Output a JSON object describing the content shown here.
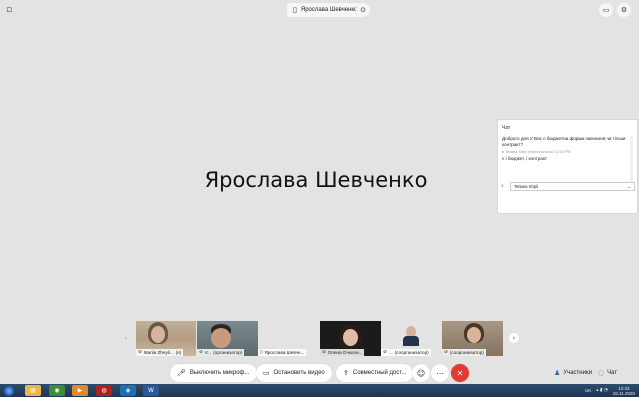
{
  "window": {
    "corner_icon": "window-icon",
    "active_speaker_pill": {
      "icon": "phone-icon",
      "name": "Ярослава Шевченко"
    },
    "pin_icon": "pin-icon",
    "top_right_icons": [
      "fullscreen-icon",
      "settings-icon"
    ]
  },
  "main_stage": {
    "speaker_name": "Ярослава Шевченко"
  },
  "chat": {
    "title": "Чат",
    "message": "Доброго дня.У Вас є бюджетна форма навчання,чи тільки контракт?",
    "meta": "в Tetiana Shpil (персонально)    12:33 PM",
    "reply": "є і бюджет, і контракт",
    "recipient": "Tetiana Shpil",
    "attach_icon": "paperclip-icon",
    "dropdown_icon": "chevron-down-icon"
  },
  "participants": [
    {
      "name": "Mariia Zheyli...",
      "extra": "(я)",
      "mic": "mic-muted-icon",
      "style": "vid-a"
    },
    {
      "name": "V...",
      "extra": "(организатор)",
      "mic": "mic-muted-icon",
      "style": "vid-b"
    },
    {
      "name": "Ярослава Шевче...",
      "extra": "",
      "mic": "phone-icon",
      "style": "vid-d"
    },
    {
      "name": "Олена Очколи...",
      "extra": "",
      "mic": "mic-muted-icon",
      "style": "vid-c"
    },
    {
      "name": "...",
      "extra": "(соорганизатор)",
      "mic": "mic-muted-icon",
      "style": "vid-d"
    },
    {
      "name": "",
      "extra": "(соорганизатор)",
      "mic": "mic-muted-icon",
      "style": "vid-e"
    }
  ],
  "strip_nav": {
    "prev": "‹",
    "next": "›"
  },
  "controls": {
    "mute_label": "Выключить микроф...",
    "video_label": "Остановить видео",
    "share_label": "Совместный дост...",
    "emoji_icon": "emoji-icon",
    "more_icon": "more-icon",
    "hangup_icon": "hangup-icon",
    "participants_label": "Участники",
    "chat_label": "Чат"
  },
  "taskbar": {
    "language": "UK",
    "time": "12:33",
    "date": "18.11.2020",
    "apps": [
      "explorer-icon",
      "chrome-icon",
      "media-icon",
      "game-icon",
      "webex-icon",
      "skype-icon",
      "word-icon"
    ]
  },
  "colors": {
    "hangup": "#e53935",
    "taskbar": "#1f3550",
    "stage": "#e3e3e3"
  }
}
